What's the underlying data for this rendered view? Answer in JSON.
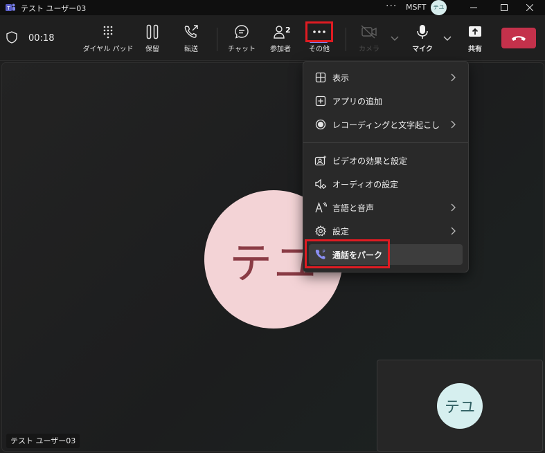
{
  "window": {
    "title": "テスト ユーザー03",
    "org": "MSFT",
    "user_initials": "テユ"
  },
  "call": {
    "timer": "00:18",
    "participant_count": "2",
    "toolbar": {
      "dialpad": "ダイヤル パッド",
      "hold": "保留",
      "transfer": "転送",
      "chat": "チャット",
      "participants": "参加者",
      "more": "その他",
      "camera": "カメラ",
      "mic": "マイク",
      "share": "共有"
    },
    "end_call_color": "#c4314b"
  },
  "menu": {
    "items": [
      {
        "label": "表示",
        "icon": "grid-icon",
        "has_submenu": true
      },
      {
        "label": "アプリの追加",
        "icon": "add-app-icon",
        "has_submenu": false
      },
      {
        "label": "レコーディングと文字起こし",
        "icon": "record-icon",
        "has_submenu": true
      },
      {
        "label": "ビデオの効果と設定",
        "icon": "video-effects-icon",
        "has_submenu": false
      },
      {
        "label": "オーディオの設定",
        "icon": "speaker-settings-icon",
        "has_submenu": false
      },
      {
        "label": "言語と音声",
        "icon": "language-icon",
        "has_submenu": true
      },
      {
        "label": "設定",
        "icon": "gear-icon",
        "has_submenu": true
      },
      {
        "label": "通話をパーク",
        "icon": "park-call-icon",
        "has_submenu": false
      }
    ]
  },
  "stage": {
    "main_avatar_initials": "テユ",
    "name_tag": "テスト ユーザー03",
    "self_avatar_initials": "テユ"
  },
  "colors": {
    "accent": "#7f85f5",
    "highlight_box": "#e01b22",
    "main_avatar_bg": "#f3d3d6",
    "self_avatar_bg": "#d6efef"
  }
}
